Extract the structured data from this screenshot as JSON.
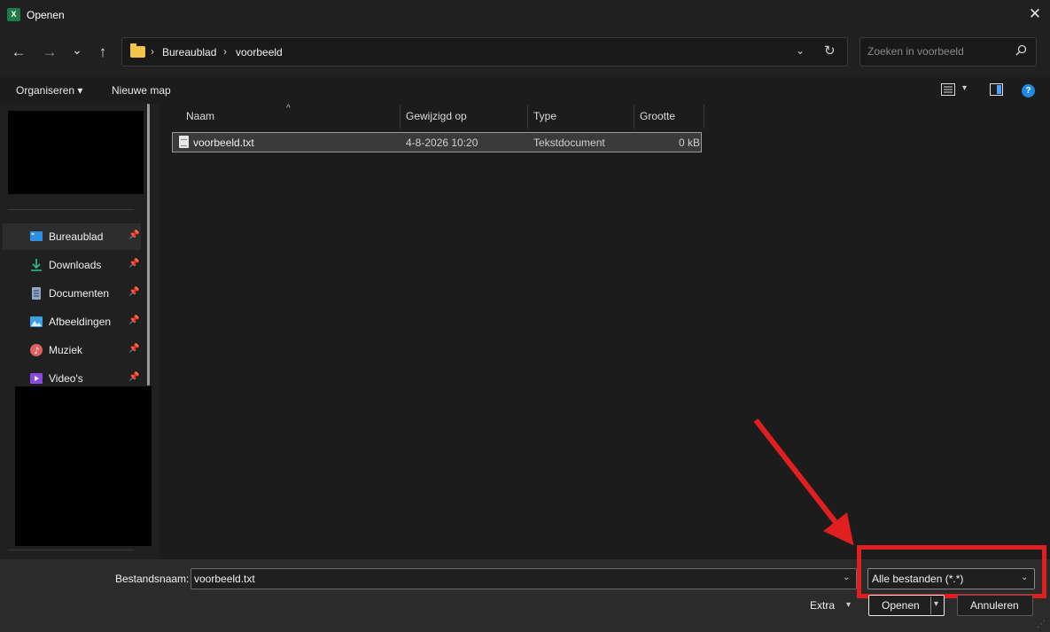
{
  "window": {
    "title": "Openen",
    "app_icon": "X",
    "close_glyph": "✕"
  },
  "nav": {
    "back_glyph": "←",
    "forward_glyph": "→",
    "recent_glyph": "⌄",
    "up_glyph": "↑",
    "breadcrumbs": [
      "Bureaublad",
      "voorbeeld"
    ],
    "crumb_sep": "›",
    "dropdown_glyph": "⌄",
    "refresh_glyph": "↻",
    "search_placeholder": "Zoeken in voorbeeld"
  },
  "commandbar": {
    "organize_label": "Organiseren ▾",
    "new_folder_label": "Nieuwe map",
    "help_glyph": "?",
    "view_dd_glyph": "▾"
  },
  "sidebar": {
    "pin_glyph": "📌",
    "items": [
      {
        "label": "Bureaublad",
        "icon": "desktop-icon",
        "color": "#2f8fe0"
      },
      {
        "label": "Downloads",
        "icon": "download-icon",
        "color": "#2fbf8f"
      },
      {
        "label": "Documenten",
        "icon": "document-icon",
        "color": "#8fa8c8"
      },
      {
        "label": "Afbeeldingen",
        "icon": "pictures-icon",
        "color": "#3aa0e0"
      },
      {
        "label": "Muziek",
        "icon": "music-icon",
        "color": "#e06060"
      },
      {
        "label": "Video's",
        "icon": "video-icon",
        "color": "#8a4ae0"
      }
    ]
  },
  "filelist": {
    "columns": [
      "Naam",
      "Gewijzigd op",
      "Type",
      "Grootte"
    ],
    "sort_glyph": "^",
    "rows": [
      {
        "name": "voorbeeld.txt",
        "modified": "4-8-2026 10:20",
        "type": "Tekstdocument",
        "size": "0 kB"
      }
    ]
  },
  "footer": {
    "filename_label": "Bestandsnaam:",
    "filename_value": "voorbeeld.txt",
    "filetype_value": "Alle bestanden (*.*)",
    "extra_label": "Extra",
    "open_label": "Openen",
    "cancel_label": "Annuleren",
    "dd_glyph": "⌄",
    "small_dd_glyph": "▾",
    "grip_glyph": "⋰"
  },
  "colors": {
    "highlight_red": "#e02020",
    "help_blue": "#1e88e5",
    "folder_yellow": "#f3c44d"
  }
}
